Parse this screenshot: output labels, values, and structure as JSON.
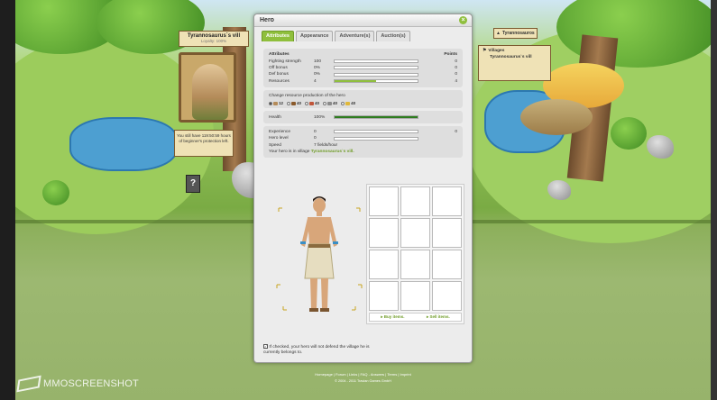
{
  "left_village": {
    "name": "Tyrannosaurus`s vill",
    "loyalty": "Loyalty: 100%",
    "protection": "You still have 119:50:59 hours of beginner's protection left.",
    "help": "?"
  },
  "right_panel": {
    "player": "Tyrannosauros",
    "villages_label": "Villages",
    "village": "Tyrannosaurus`s vill"
  },
  "hero": {
    "title": "Hero",
    "tabs": [
      "Attributes",
      "Appearance",
      "Adventure(s)",
      "Auction(s)"
    ],
    "attributes_header": "Attributes",
    "points_header": "Points",
    "attributes": [
      {
        "label": "Fighting strength",
        "value": "100",
        "fill": 0.0,
        "points": "0"
      },
      {
        "label": "Off bonus",
        "value": "0%",
        "fill": 0.0,
        "points": "0"
      },
      {
        "label": "Def bonus",
        "value": "0%",
        "fill": 0.0,
        "points": "0"
      },
      {
        "label": "Resources",
        "value": "4",
        "fill": 0.5,
        "points": "4"
      }
    ],
    "resource_title": "Change resource production of the hero",
    "resources": [
      "12",
      "40",
      "40",
      "40",
      "40"
    ],
    "health": {
      "label": "Health",
      "value": "100%",
      "fill": 1.0
    },
    "experience": {
      "label": "Experience",
      "value": "0",
      "points": "0"
    },
    "level": {
      "label": "Hero level",
      "value": "0"
    },
    "speed": {
      "label": "Speed",
      "value": "7 fields/hour"
    },
    "location_text": "Your hero is in village",
    "location_village": "Tyrannosaurus`s vill.",
    "buy": "▸ Buy items.",
    "sell": "▸ Sell items.",
    "checkbox_text": "If checked, your hero will not defend the village he is currently belongs to."
  },
  "footer": {
    "links": "Homepage  |  Forum  |  Links  |  FAQ - Answers  |  Terms  |  Imprint",
    "copyright": "© 2004 - 2011 Travian Games GmbH"
  },
  "watermark": "MMOSCREENSHOT"
}
